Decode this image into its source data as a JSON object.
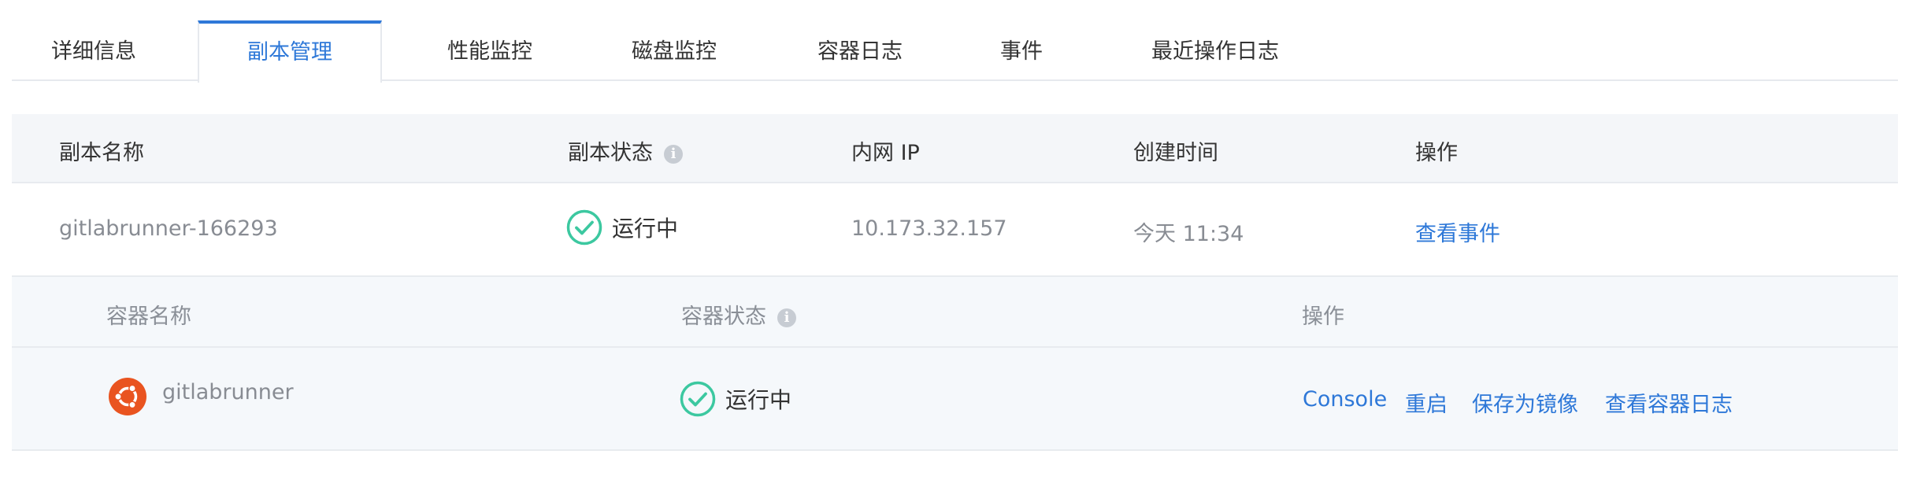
{
  "tabs": [
    {
      "label": "详细信息",
      "active": false
    },
    {
      "label": "副本管理",
      "active": true
    },
    {
      "label": "性能监控",
      "active": false
    },
    {
      "label": "磁盘监控",
      "active": false
    },
    {
      "label": "容器日志",
      "active": false
    },
    {
      "label": "事件",
      "active": false
    },
    {
      "label": "最近操作日志",
      "active": false
    }
  ],
  "replica_table": {
    "headers": {
      "name": "副本名称",
      "status": "副本状态",
      "ip": "内网 IP",
      "created": "创建时间",
      "actions": "操作"
    },
    "rows": [
      {
        "name": "gitlabrunner-166293",
        "status": "运行中",
        "ip": "10.173.32.157",
        "created": "今天 11:34",
        "action": "查看事件"
      }
    ]
  },
  "container_table": {
    "headers": {
      "name": "容器名称",
      "status": "容器状态",
      "actions": "操作"
    },
    "rows": [
      {
        "name": "gitlabrunner",
        "icon": "ubuntu-icon",
        "status": "运行中",
        "actions": [
          "Console",
          "重启",
          "保存为镜像",
          "查看容器日志"
        ]
      }
    ]
  },
  "colors": {
    "accent": "#2e78d8",
    "status_ok": "#3cc8a0",
    "ubuntu": "#e95420"
  }
}
